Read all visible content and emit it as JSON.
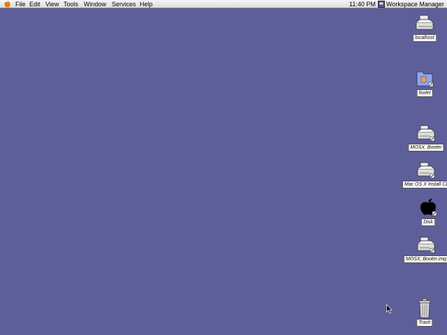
{
  "menubar": {
    "apple_icon": "apple-icon",
    "items": [
      "File",
      "Edit",
      "View",
      "Tools",
      "Window",
      "Services",
      "Help"
    ],
    "clock": "11:40 PM",
    "app_name": "Workspace Manager"
  },
  "desktop": {
    "background": "#5e5e9a",
    "icons": [
      {
        "label": "localhost",
        "icon": "server-drive-icon"
      },
      {
        "label": "foxlet",
        "icon": "home-folder-icon"
      },
      {
        "label": "MOSX_Booter",
        "icon": "network-drive-icon"
      },
      {
        "label": "Mac OS X Install CD",
        "icon": "network-drive-icon"
      },
      {
        "label": "Disk",
        "icon": "apple-disk-icon"
      },
      {
        "label": "MOSX_Booter.img",
        "icon": "network-drive-icon"
      },
      {
        "label": "Trash",
        "icon": "trash-icon"
      }
    ]
  }
}
